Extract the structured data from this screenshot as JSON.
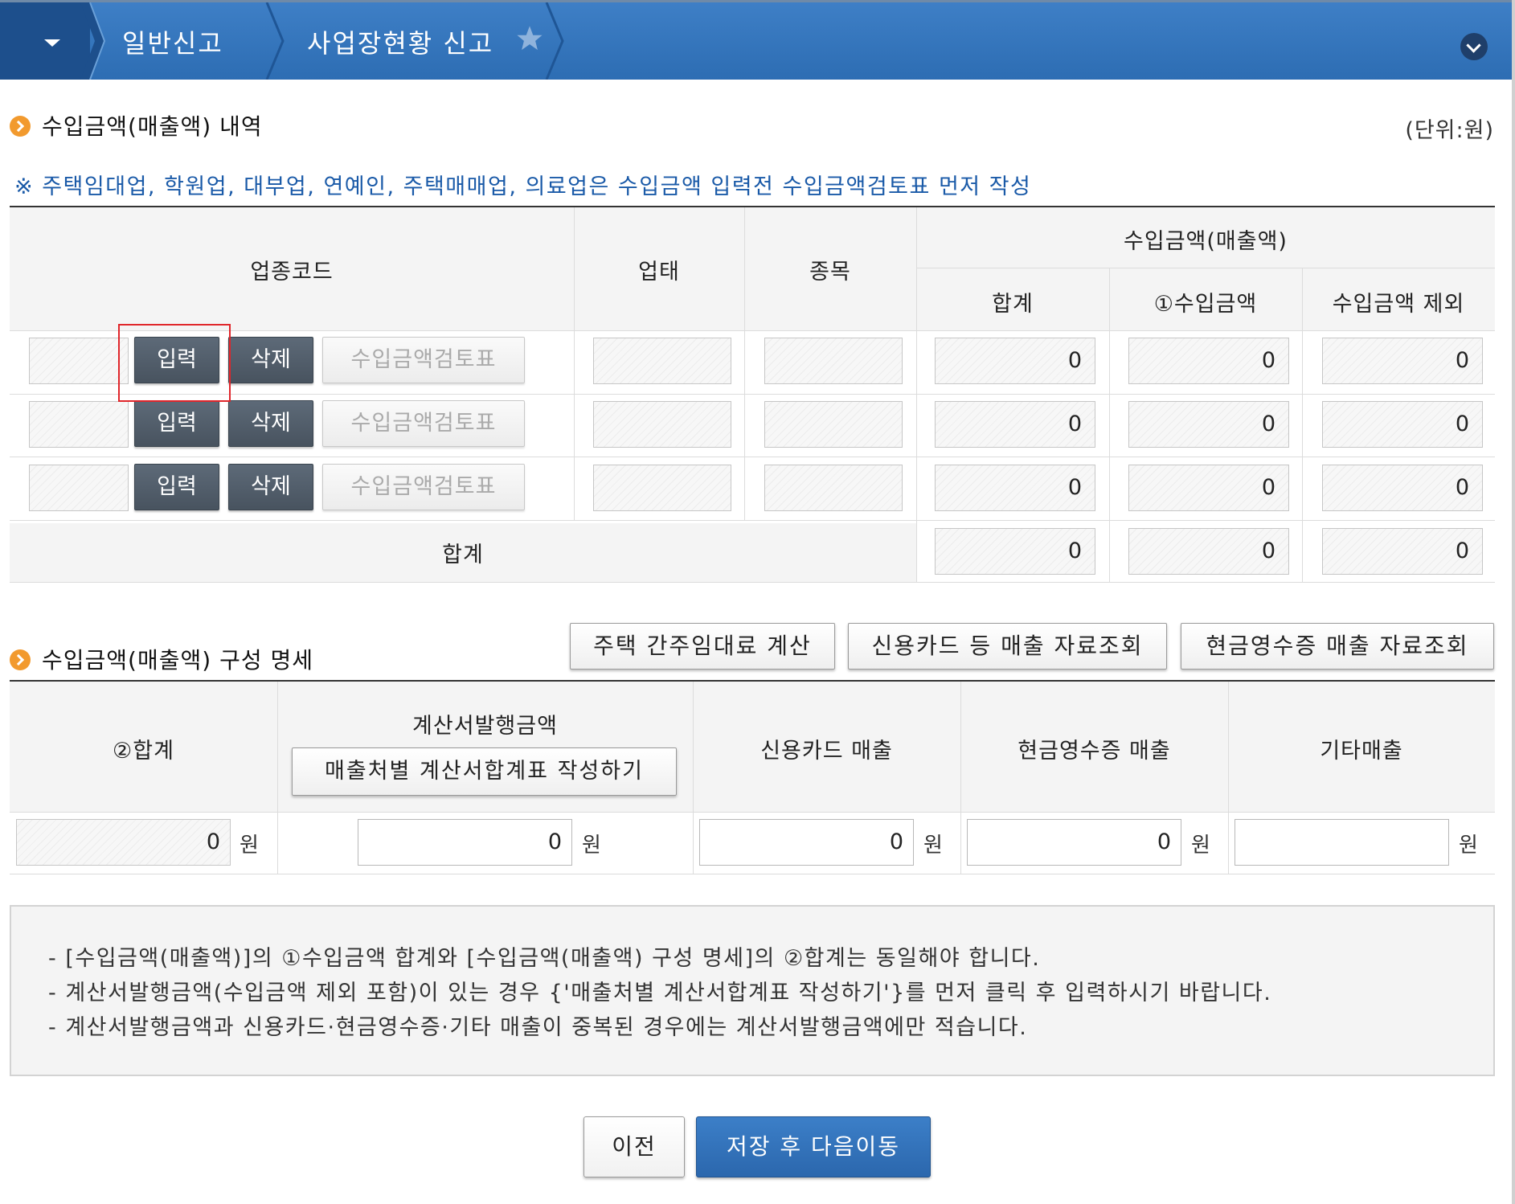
{
  "nav": {
    "crumbs": [
      "일반신고",
      "사업장현황 신고"
    ],
    "favorite_icon": "star-icon",
    "menu_icon": "caret-down-icon",
    "expand_icon": "chevron-down-icon"
  },
  "revenue": {
    "title": "수입금액(매출액) 내역",
    "unit": "(단위:원)",
    "notice": "※ 주택임대업, 학원업, 대부업, 연예인, 주택매매업, 의료업은 수입금액 입력전 수입금액검토표 먼저 작성",
    "headers": {
      "code": "업종코드",
      "type": "업태",
      "item": "종목",
      "amount_group": "수입금액(매출액)",
      "total": "합계",
      "income": "①수입금액",
      "excluded": "수입금액 제외"
    },
    "rows": [
      {
        "input_label": "입력",
        "delete_label": "삭제",
        "review_label": "수입금액검토표",
        "total": "0",
        "income": "0",
        "excluded": "0"
      },
      {
        "input_label": "입력",
        "delete_label": "삭제",
        "review_label": "수입금액검토표",
        "total": "0",
        "income": "0",
        "excluded": "0"
      },
      {
        "input_label": "입력",
        "delete_label": "삭제",
        "review_label": "수입금액검토표",
        "total": "0",
        "income": "0",
        "excluded": "0"
      }
    ],
    "sum": {
      "label": "합계",
      "total": "0",
      "income": "0",
      "excluded": "0"
    }
  },
  "composition": {
    "title": "수입금액(매출액) 구성 명세",
    "buttons": [
      "주택 간주임대료 계산",
      "신용카드 등 매출 자료조회",
      "현금영수증 매출 자료조회"
    ],
    "headers": {
      "total": "②합계",
      "invoice": "계산서발행금액",
      "invoice_button": "매출처별 계산서합계표 작성하기",
      "card": "신용카드 매출",
      "cash": "현금영수증 매출",
      "other": "기타매출"
    },
    "values": {
      "total": "0",
      "invoice": "0",
      "card": "0",
      "cash": "0",
      "other": ""
    },
    "currency": "원"
  },
  "info_lines": [
    "- [수입금액(매출액)]의 ①수입금액 합계와 [수입금액(매출액) 구성 명세]의 ②합계는 동일해야 합니다.",
    "- 계산서발행금액(수입금액 제외 포함)이 있는 경우 {'매출처별 계산서합계표 작성하기'}를 먼저 클릭 후 입력하시기 바랍니다.",
    "- 계산서발행금액과 신용카드·현금영수증·기타 매출이 중복된 경우에는 계산서발행금액에만 적습니다."
  ],
  "footer": {
    "prev_label": "이전",
    "next_label": "저장 후 다음이동"
  },
  "colors": {
    "nav_blue": "#3577bf",
    "accent_orange": "#f29a2e",
    "notice_blue": "#1a5aa8",
    "highlight_red": "#e0262b"
  }
}
